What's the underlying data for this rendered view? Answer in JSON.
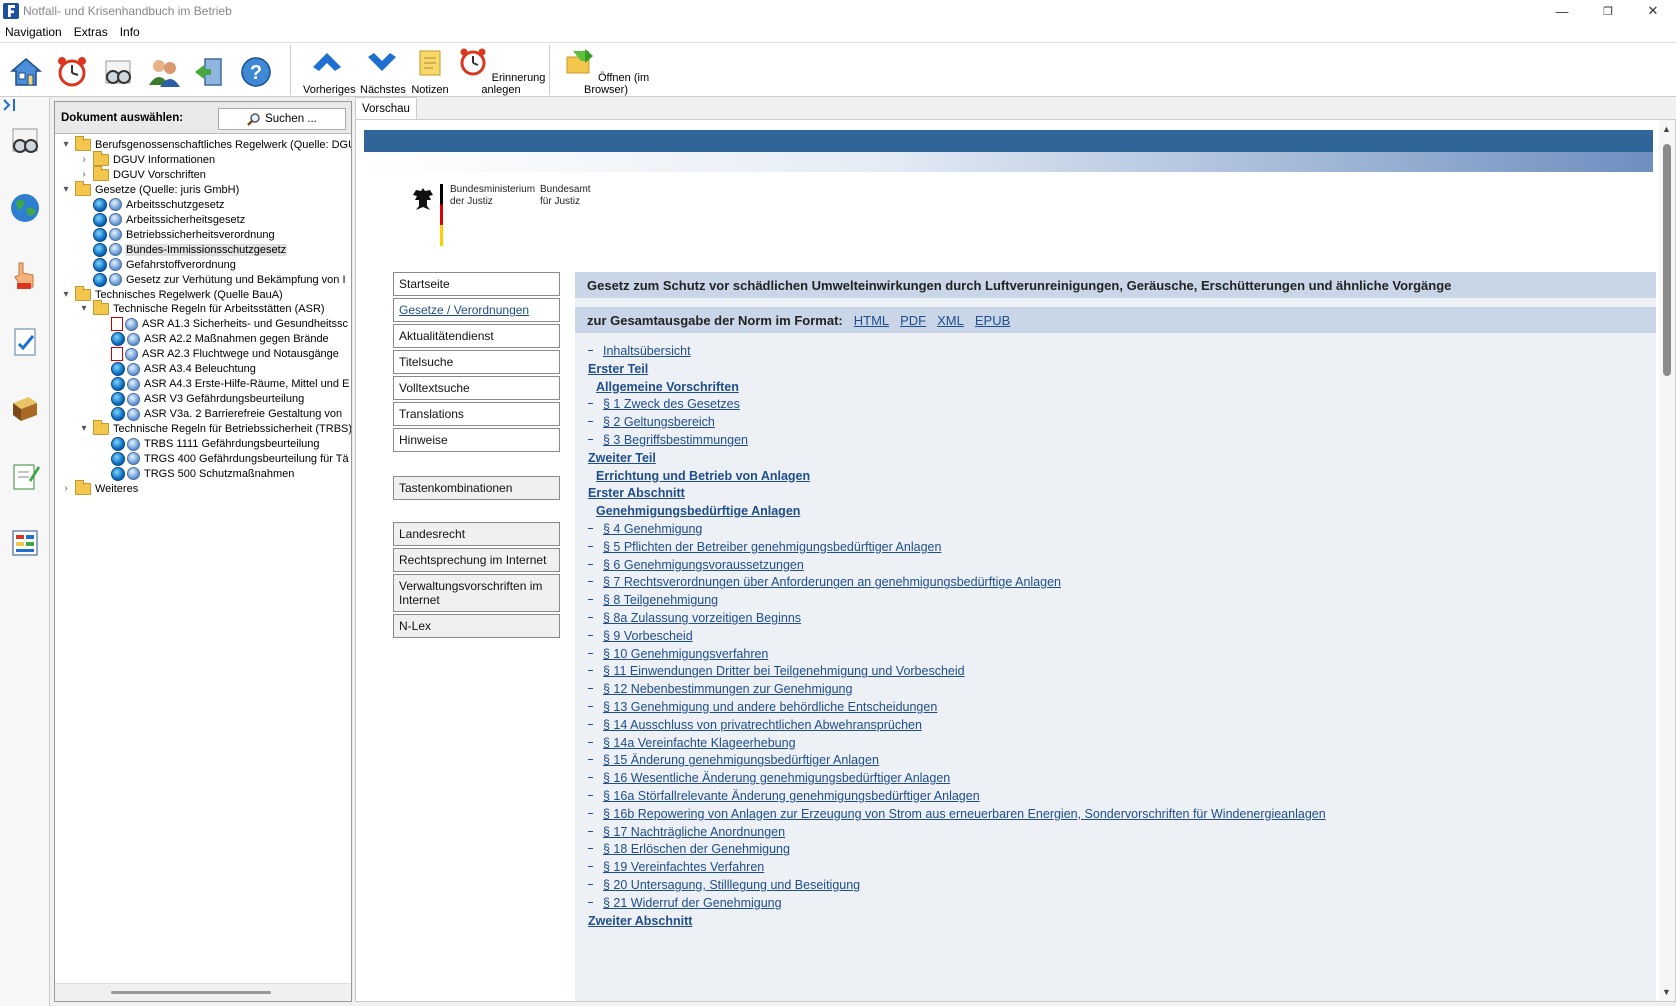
{
  "window": {
    "title": "Notfall- und Krisenhandbuch im Betrieb",
    "minimize": "—",
    "maximize": "❐",
    "close": "✕"
  },
  "menu": [
    "Navigation",
    "Extras",
    "Info"
  ],
  "toolbar": {
    "vorheriges": "Vorheriges",
    "naechstes": "Nächstes",
    "notizen": "Notizen",
    "erinnerung": "Erinnerung anlegen",
    "oeffnen": "Öffnen (im Browser)"
  },
  "panel": {
    "heading": "Dokument auswählen:",
    "search": "Suchen ...",
    "tree": [
      {
        "label": "Berufsgenossenschaftliches Regelwerk (Quelle: DGUV",
        "exp": "▾",
        "type": "folder"
      },
      {
        "label": "DGUV Informationen",
        "exp": "›",
        "type": "folder"
      },
      {
        "label": "DGUV Vorschriften",
        "exp": "›",
        "type": "folder"
      },
      {
        "label": "Gesetze (Quelle: juris GmbH)",
        "exp": "▾",
        "type": "folder"
      },
      {
        "label": "Arbeitsschutzgesetz",
        "type": "doc"
      },
      {
        "label": "Arbeitssicherheitsgesetz",
        "type": "doc"
      },
      {
        "label": "Betriebssicherheitsverordnung",
        "type": "doc"
      },
      {
        "label": "Bundes-Immissionsschutzgesetz",
        "type": "doc"
      },
      {
        "label": "Gefahrstoffverordnung",
        "type": "doc"
      },
      {
        "label": "Gesetz zur Verhütung und Bekämpfung von I",
        "type": "doc"
      },
      {
        "label": "Technisches Regelwerk (Quelle BauA)",
        "exp": "▾",
        "type": "folder"
      },
      {
        "label": "Technische Regeln für Arbeitsstätten (ASR)",
        "exp": "▾",
        "type": "folder"
      },
      {
        "label": "ASR A1.3 Sicherheits- und Gesundheitssc",
        "type": "pdf"
      },
      {
        "label": "ASR A2.2 Maßnahmen gegen Brände",
        "type": "doc"
      },
      {
        "label": "ASR A2.3 Fluchtwege und Notausgänge",
        "type": "pdf"
      },
      {
        "label": "ASR A3.4 Beleuchtung",
        "type": "doc"
      },
      {
        "label": "ASR A4.3 Erste-Hilfe-Räume, Mittel und E",
        "type": "doc"
      },
      {
        "label": "ASR V3 Gefährdungsbeurteilung",
        "type": "doc"
      },
      {
        "label": "ASR V3a. 2 Barrierefreie Gestaltung von",
        "type": "doc"
      },
      {
        "label": "Technische Regeln für Betriebssicherheit (TRBS)",
        "exp": "▾",
        "type": "folder"
      },
      {
        "label": "TRBS 1111 Gefährdungsbeurteilung",
        "type": "doc"
      },
      {
        "label": "TRGS 400 Gefährdungsbeurteilung für Tä",
        "type": "doc"
      },
      {
        "label": "TRGS 500 Schutzmaßnahmen",
        "type": "doc"
      },
      {
        "label": "Weiteres",
        "exp": "›",
        "type": "folder"
      }
    ]
  },
  "tab": "Vorschau",
  "logo": {
    "ministry": "Bundesministerium\nder Justiz",
    "office": "Bundesamt\nfür Justiz"
  },
  "nav": {
    "startseite": "Startseite",
    "gesetze": "Gesetze / Verordnungen",
    "aktualitaet": "Aktualitätendienst",
    "titelsuche": "Titelsuche",
    "volltext": "Volltextsuche",
    "translations": "Translations",
    "hinweise": "Hinweise",
    "tasten": "Tastenkombinationen",
    "landesrecht": "Landesrecht",
    "rechtsprechung": "Rechtsprechung im Internet",
    "verwaltung": "Verwaltungsvorschriften im Internet",
    "nlex": "N-Lex"
  },
  "doc": {
    "title": "Gesetz zum Schutz vor schädlichen Umwelteinwirkungen durch Luftverunreinigungen, Geräusche, Erschütterungen und ähnliche Vorgänge",
    "format_label": "zur Gesamtausgabe der Norm im Format:",
    "formats": [
      "HTML",
      "PDF",
      "XML",
      "EPUB"
    ],
    "toc": [
      {
        "text": "Inhaltsübersicht",
        "kind": "link"
      },
      {
        "text": "Erster Teil",
        "kind": "h"
      },
      {
        "text": "Allgemeine Vorschriften",
        "kind": "sub"
      },
      {
        "text": "§ 1 Zweck des Gesetzes",
        "kind": "link"
      },
      {
        "text": "§ 2 Geltungsbereich",
        "kind": "link"
      },
      {
        "text": "§ 3 Begriffsbestimmungen",
        "kind": "link"
      },
      {
        "text": "Zweiter Teil",
        "kind": "h"
      },
      {
        "text": "Errichtung und Betrieb von Anlagen",
        "kind": "sub"
      },
      {
        "text": "Erster Abschnitt",
        "kind": "h"
      },
      {
        "text": "Genehmigungsbedürftige Anlagen",
        "kind": "sub"
      },
      {
        "text": "§ 4 Genehmigung",
        "kind": "link"
      },
      {
        "text": "§ 5 Pflichten der Betreiber genehmigungsbedürftiger Anlagen",
        "kind": "link"
      },
      {
        "text": "§ 6 Genehmigungsvoraussetzungen",
        "kind": "link"
      },
      {
        "text": "§ 7 Rechtsverordnungen über Anforderungen an genehmigungsbedürftige Anlagen",
        "kind": "link"
      },
      {
        "text": "§ 8 Teilgenehmigung",
        "kind": "link"
      },
      {
        "text": "§ 8a Zulassung vorzeitigen Beginns",
        "kind": "link"
      },
      {
        "text": "§ 9 Vorbescheid",
        "kind": "link"
      },
      {
        "text": "§ 10 Genehmigungsverfahren",
        "kind": "link"
      },
      {
        "text": "§ 11 Einwendungen Dritter bei Teilgenehmigung und Vorbescheid",
        "kind": "link"
      },
      {
        "text": "§ 12 Nebenbestimmungen zur Genehmigung",
        "kind": "link"
      },
      {
        "text": "§ 13 Genehmigung und andere behördliche Entscheidungen",
        "kind": "link"
      },
      {
        "text": "§ 14 Ausschluss von privatrechtlichen Abwehransprüchen",
        "kind": "link"
      },
      {
        "text": "§ 14a Vereinfachte Klageerhebung",
        "kind": "link"
      },
      {
        "text": "§ 15 Änderung genehmigungsbedürftiger Anlagen",
        "kind": "link"
      },
      {
        "text": "§ 16 Wesentliche Änderung genehmigungsbedürftiger Anlagen",
        "kind": "link"
      },
      {
        "text": "§ 16a Störfallrelevante Änderung genehmigungsbedürftiger Anlagen",
        "kind": "link"
      },
      {
        "text": "§ 16b Repowering von Anlagen zur Erzeugung von Strom aus erneuerbaren Energien, Sondervorschriften für Windenergieanlagen",
        "kind": "link"
      },
      {
        "text": "§ 17 Nachträgliche Anordnungen",
        "kind": "link"
      },
      {
        "text": "§ 18 Erlöschen der Genehmigung",
        "kind": "link"
      },
      {
        "text": "§ 19 Vereinfachtes Verfahren",
        "kind": "link"
      },
      {
        "text": "§ 20 Untersagung, Stilllegung und Beseitigung",
        "kind": "link"
      },
      {
        "text": "§ 21 Widerruf der Genehmigung",
        "kind": "link"
      },
      {
        "text": "Zweiter Abschnitt",
        "kind": "h"
      }
    ]
  }
}
